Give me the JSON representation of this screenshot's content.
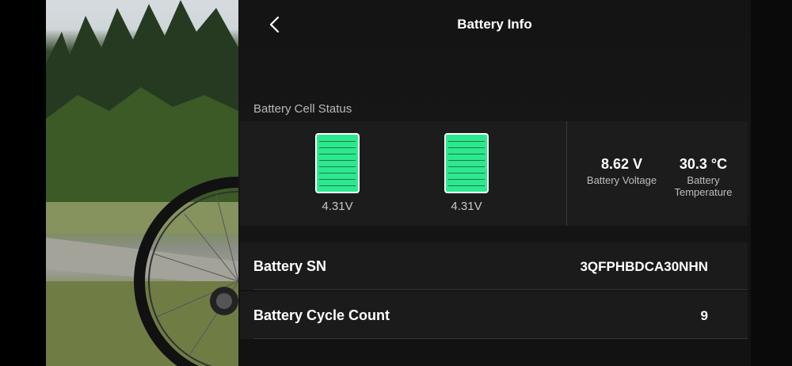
{
  "header": {
    "title": "Battery Info"
  },
  "cell_status": {
    "label": "Battery Cell Status",
    "cells": [
      {
        "voltage": "4.31V"
      },
      {
        "voltage": "4.31V"
      }
    ],
    "battery_voltage": {
      "value": "8.62 V",
      "label": "Battery Voltage"
    },
    "battery_temperature": {
      "value": "30.3 °C",
      "label_line1": "Battery",
      "label_line2": "Temperature"
    }
  },
  "details": {
    "sn": {
      "label": "Battery SN",
      "value": "3QFPHBDCA30NHN"
    },
    "cycle_count": {
      "label": "Battery Cycle Count",
      "value": "9"
    }
  },
  "colors": {
    "cell_fill": "#2ee88e",
    "panel_bg": "#141414"
  },
  "icons": {
    "back": "chevron-left-icon"
  }
}
